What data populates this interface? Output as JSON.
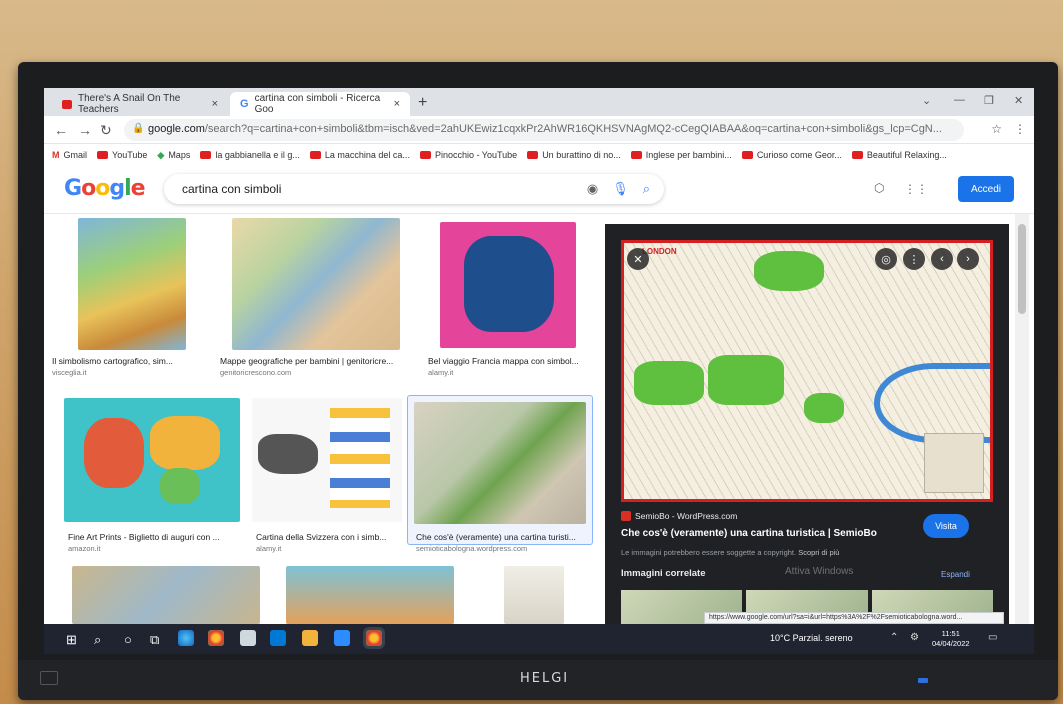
{
  "browser": {
    "tabs": [
      {
        "title": "There's A Snail On The Teachers",
        "close": "×"
      },
      {
        "title": "cartina con simboli - Ricerca Goo",
        "close": "×"
      }
    ],
    "new_tab": "+",
    "url_host": "google.com",
    "url_rest": "/search?q=cartina+con+simboli&tbm=isch&ved=2ahUKEwiz1cqxkPr2AhWR16QKHSVNAgMQ2-cCegQIABAA&oq=cartina+con+simboli&gs_lcp=CgN...",
    "bookmarks": [
      {
        "label": "Gmail",
        "type": "gmail"
      },
      {
        "label": "YouTube",
        "type": "yt"
      },
      {
        "label": "Maps",
        "type": "maps"
      },
      {
        "label": "la gabbianella e il g...",
        "type": "yt"
      },
      {
        "label": "La macchina del ca...",
        "type": "yt"
      },
      {
        "label": "Pinocchio - YouTube",
        "type": "yt"
      },
      {
        "label": "Un burattino di no...",
        "type": "yt"
      },
      {
        "label": "Inglese per bambini...",
        "type": "yt"
      },
      {
        "label": "Curioso come Geor...",
        "type": "yt"
      },
      {
        "label": "Beautiful Relaxing...",
        "type": "yt"
      }
    ]
  },
  "google": {
    "logo": [
      "G",
      "o",
      "o",
      "g",
      "l",
      "e"
    ],
    "query": "cartina con simboli",
    "login_label": "Accedi"
  },
  "results": [
    {
      "title": "Il simbolismo cartografico, sim...",
      "source": "visceglia.it"
    },
    {
      "title": "Mappe geografiche per bambini | genitoricre...",
      "source": "genitoricrescono.com"
    },
    {
      "title": "Bel viaggio Francia mappa con simbol...",
      "source": "alamy.it"
    },
    {
      "title": "Fine Art Prints - Biglietto di auguri con ...",
      "source": "amazon.it"
    },
    {
      "title": "Cartina della Svizzera con i simb...",
      "source": "alamy.it"
    },
    {
      "title": "Che cos'è (veramente) una cartina turisti...",
      "source": "semioticabologna.wordpress.com"
    }
  ],
  "preview": {
    "source": "SemioBo - WordPress.com",
    "title": "Che cos'è (veramente) una cartina turistica | SemioBo",
    "visit_label": "Visita",
    "copyright": "Le immagini potrebbero essere soggette a copyright.",
    "learn_more": "Scopri di più",
    "related_heading": "Immagini correlate",
    "more": "Espandi",
    "watermark": "Attiva Windows",
    "image_label": "LONDON"
  },
  "status_url": "https://www.google.com/url?sa=i&url=https%3A%2F%2Fsemioticabologna.word...",
  "taskbar": {
    "weather": "10°C  Parzial. sereno",
    "time": "11:51",
    "date": "04/04/2022"
  },
  "tv": {
    "brand": "HELGI"
  }
}
